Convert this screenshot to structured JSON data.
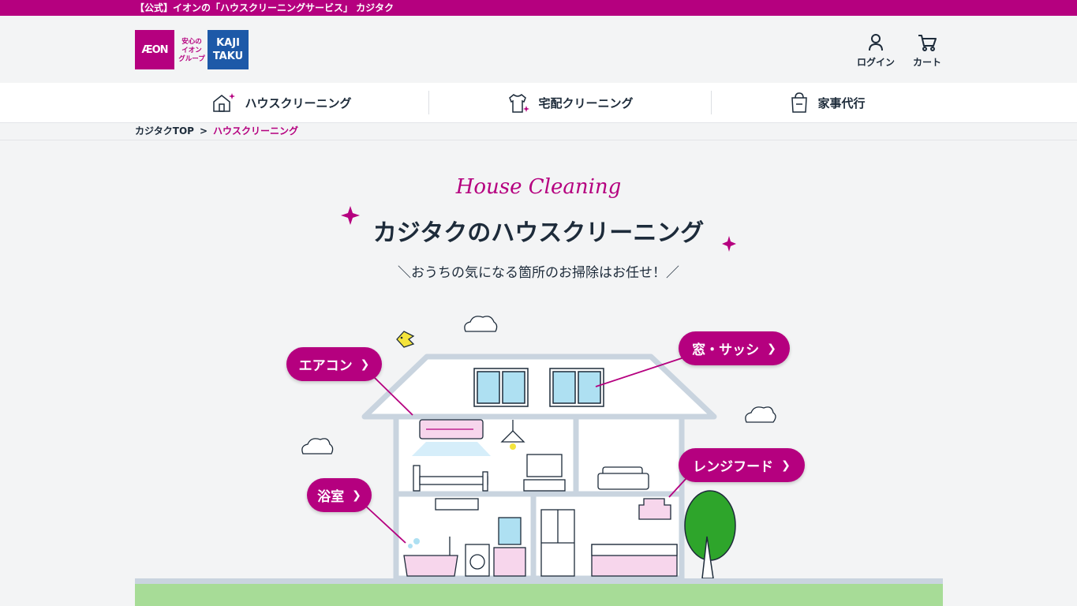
{
  "topbar": {
    "text": "【公式】イオンの「ハウスクリーニングサービス」 カジタク"
  },
  "logo": {
    "aeon": "ÆON",
    "anshin_1": "安心の",
    "anshin_2": "イオン",
    "anshin_3": "グループ",
    "kaji": "KAJI",
    "taku": "TAKU"
  },
  "header": {
    "login_label": "ログイン",
    "cart_label": "カート"
  },
  "nav": {
    "items": [
      {
        "label": "ハウスクリーニング",
        "icon": "house-sparkle-icon"
      },
      {
        "label": "宅配クリーニング",
        "icon": "shirt-sparkle-icon"
      },
      {
        "label": "家事代行",
        "icon": "bag-icon"
      }
    ]
  },
  "breadcrumb": {
    "home": "カジタクTOP",
    "separator": ">",
    "current": "ハウスクリーニング"
  },
  "hero": {
    "script_title": "House Cleaning",
    "title": "カジタクのハウスクリーニング",
    "subtitle": "＼おうちの気になる箇所のお掃除はお任せ！／"
  },
  "menu_buttons": {
    "aircon": "エアコン",
    "window": "窓・サッシ",
    "rangehood": "レンジフード",
    "bath": "浴室"
  },
  "colors": {
    "brand": "#b5007f",
    "kaji_blue": "#1d59a8",
    "ground": "#a7dc97"
  }
}
